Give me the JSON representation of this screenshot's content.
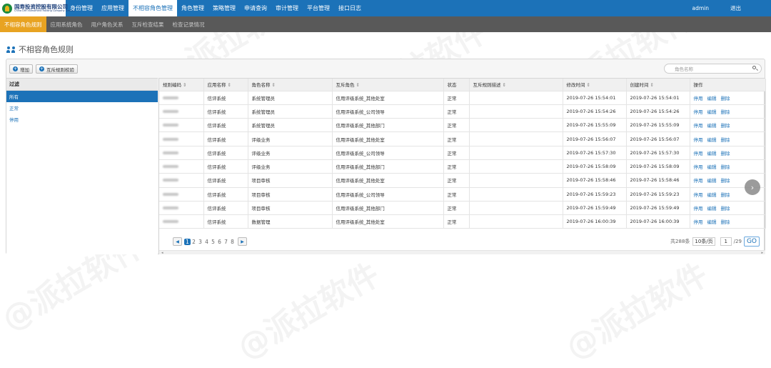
{
  "logo": {
    "name": "国寿投资控股有限公司",
    "name_en": "China Life Investment Holding Company Limited"
  },
  "topnav": [
    "身份管理",
    "应用管理",
    "不相容角色管理",
    "角色管理",
    "策略管理",
    "申请查询",
    "审计管理",
    "平台管理",
    "接口日志"
  ],
  "topnav_active": 2,
  "user": {
    "name": "admin",
    "logout": "退出"
  },
  "subnav": [
    "不相容角色规则",
    "应用系统角色",
    "用户角色关系",
    "互斥检查结果",
    "检查记录情况"
  ],
  "page_title": "不相容角色规则",
  "toolbar": {
    "add": "增加",
    "check": "互斥规则校验"
  },
  "search": {
    "placeholder": "角色名称"
  },
  "filter": {
    "title": "过滤",
    "items": [
      "所有",
      "正常",
      "停用"
    ],
    "selected": 0
  },
  "table": {
    "columns": [
      "规则编码",
      "应用名称",
      "角色名称",
      "互斥角色",
      "状态",
      "互斥规则描述",
      "修改时间",
      "创建时间",
      "操作"
    ],
    "sortable": [
      true,
      true,
      true,
      true,
      false,
      true,
      true,
      true,
      false
    ],
    "rows": [
      [
        "信评系统",
        "系统管理员",
        "信用评级系统_其他处室",
        "正常",
        "",
        "2019-07-26 15:54:01",
        "2019-07-26 15:54:01"
      ],
      [
        "信评系统",
        "系统管理员",
        "信用评级系统_公司领导",
        "正常",
        "",
        "2019-07-26 15:54:26",
        "2019-07-26 15:54:26"
      ],
      [
        "信评系统",
        "系统管理员",
        "信用评级系统_其他部门",
        "正常",
        "",
        "2019-07-26 15:55:09",
        "2019-07-26 15:55:09"
      ],
      [
        "信评系统",
        "评级业务",
        "信用评级系统_其他处室",
        "正常",
        "",
        "2019-07-26 15:56:07",
        "2019-07-26 15:56:07"
      ],
      [
        "信评系统",
        "评级业务",
        "信用评级系统_公司领导",
        "正常",
        "",
        "2019-07-26 15:57:30",
        "2019-07-26 15:57:30"
      ],
      [
        "信评系统",
        "评级业务",
        "信用评级系统_其他部门",
        "正常",
        "",
        "2019-07-26 15:58:09",
        "2019-07-26 15:58:09"
      ],
      [
        "信评系统",
        "项目审核",
        "信用评级系统_其他处室",
        "正常",
        "",
        "2019-07-26 15:58:46",
        "2019-07-26 15:58:46"
      ],
      [
        "信评系统",
        "项目审核",
        "信用评级系统_公司领导",
        "正常",
        "",
        "2019-07-26 15:59:23",
        "2019-07-26 15:59:23"
      ],
      [
        "信评系统",
        "项目审核",
        "信用评级系统_其他部门",
        "正常",
        "",
        "2019-07-26 15:59:49",
        "2019-07-26 15:59:49"
      ],
      [
        "信评系统",
        "数据管理",
        "信用评级系统_其他处室",
        "正常",
        "",
        "2019-07-26 16:00:39",
        "2019-07-26 16:00:39"
      ]
    ],
    "actions": [
      "停用",
      "编辑",
      "删除"
    ]
  },
  "pager": {
    "pages": [
      "1",
      "2",
      "3",
      "4",
      "5",
      "6",
      "7",
      "8"
    ],
    "current": 0,
    "total": "共288条",
    "per_page": "10条/页",
    "page_input": "1",
    "page_total": "/29",
    "go": "GO"
  },
  "watermark": "@派拉软件",
  "colors": {
    "primary": "#1c72b8",
    "subnav_active": "#e8a322",
    "subbar": "#595959"
  }
}
